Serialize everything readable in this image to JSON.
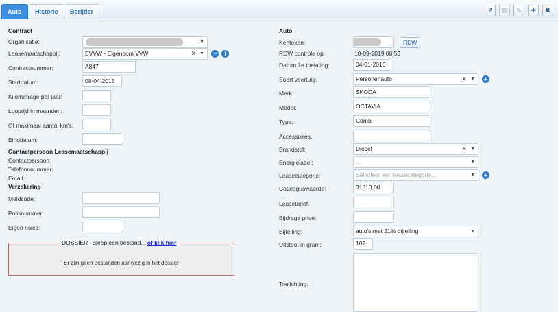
{
  "tabs": [
    {
      "label": "Auto",
      "active": true
    },
    {
      "label": "Historie",
      "active": false
    },
    {
      "label": "Berijder",
      "active": false
    }
  ],
  "toolbar": {
    "help": "?",
    "print": "▤",
    "edit": "✎",
    "add": "✚",
    "close": "✖"
  },
  "contract": {
    "heading": "Contract",
    "organisatie_label": "Organisatie:",
    "leasemaatschappij_label": "Leasemaatschappij:",
    "leasemaatschappij_value": "EVVW - Eigendom VVW",
    "contractnummer_label": "Contractnummer:",
    "contractnummer_value": "A847",
    "startdatum_label": "Startdatum:",
    "startdatum_value": "08-04-2016",
    "kilometrage_label": "Kilometrage per jaar:",
    "looptijd_label": "Looptijd in maanden:",
    "maximaal_label": "Of maximaal aantal km's:",
    "einddatum_label": "Einddatum:"
  },
  "contactpersoon": {
    "heading": "Contactpersoon Leasemaatschappij",
    "contactpersoon_label": "Contactpersoon:",
    "telefoon_label": "Telefoonnummer:",
    "email_label": "Email"
  },
  "verzekering": {
    "heading": "Verzekering",
    "meldcode_label": "Meldcode:",
    "polisnummer_label": "Polisnummer:",
    "eigen_risico_label": "Eigen risico:"
  },
  "dossier": {
    "title": "DOSSIER",
    "hint": " - sleep een bestand... ",
    "link": "of klik hier",
    "empty": "Er zijn geen bestanden aanwezig in het dossier"
  },
  "auto": {
    "heading": "Auto",
    "kenteken_label": "Kenteken:",
    "rdw_button": "RDW",
    "rdw_controle_label": "RDW controle op:",
    "rdw_controle_value": "18-09-2019 08:53",
    "datum_toelating_label": "Datum 1e toelating:",
    "datum_toelating_value": "04-01-2016",
    "soort_label": "Soort voertuig:",
    "soort_value": "Personenauto",
    "merk_label": "Merk:",
    "merk_value": "SKODA",
    "model_label": "Model:",
    "model_value": "OCTAVIA",
    "type_label": "Type:",
    "type_value": "Combi",
    "accessoires_label": "Accessoires:",
    "brandstof_label": "Brandstof:",
    "brandstof_value": "Diesel",
    "energielabel_label": "Energielabel:",
    "energielabel_value": "...",
    "leasecategorie_label": "Leasecategorie:",
    "leasecategorie_placeholder": "Selecteer een leasecategorie...",
    "cataloguswaarde_label": "Cataloguswaarde:",
    "cataloguswaarde_value": "31810,00",
    "leasetarief_label": "Leasetarief:",
    "bijdrage_label": "Bijdrage privé:",
    "bijtelling_label": "Bijtelling:",
    "bijtelling_value": "auto's met 21% bijtelling",
    "uitstoot_label": "Uitstoot in gram:",
    "uitstoot_value": "102",
    "toelichting_label": "Toelichting:"
  }
}
